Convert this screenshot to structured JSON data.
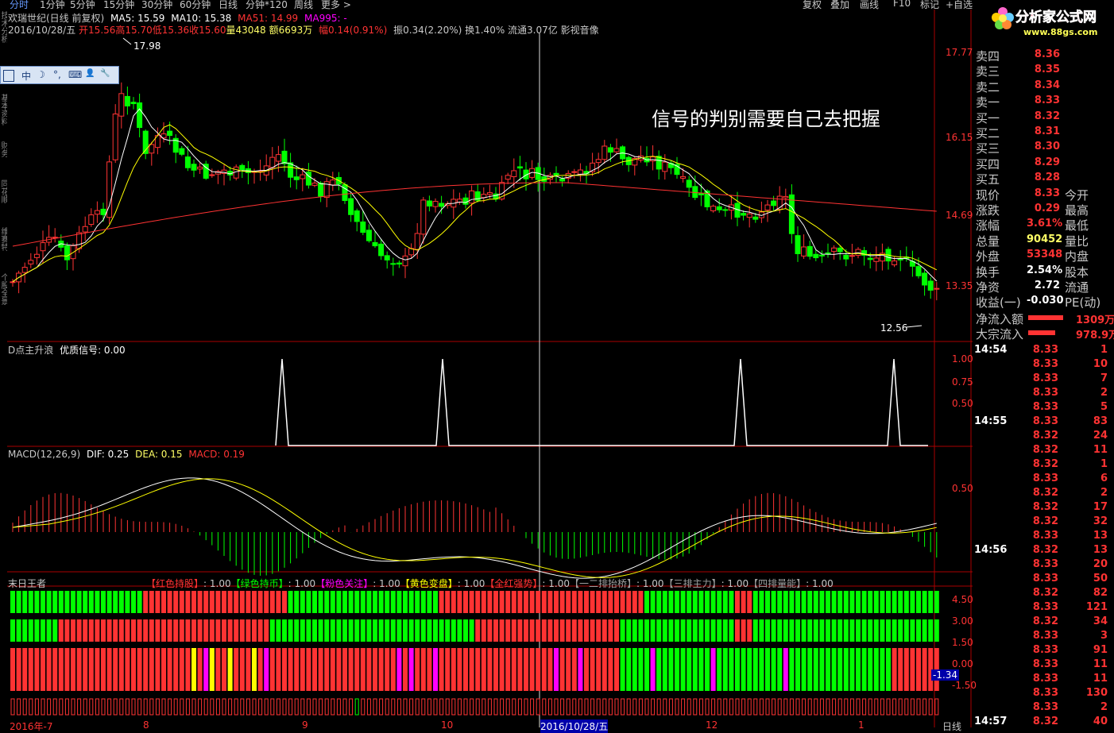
{
  "toolbar": {
    "items": [
      "分时",
      "1分钟",
      "5分钟",
      "15分钟",
      "30分钟",
      "60分钟",
      "日线",
      "分钟*120",
      "周线",
      "更多 >"
    ],
    "right_items": [
      "复权",
      "叠加",
      "画线",
      "F10",
      "标记",
      "+自选"
    ]
  },
  "sidebar_tabs": [
    "技术分析",
    "基本资料",
    "财务",
    "同花顺",
    "维赛特",
    "个股全景"
  ],
  "stock": {
    "title": "欢瑞世纪(日线 前复权)",
    "ma5": "MA5: 15.59",
    "ma10": "MA10: 15.38",
    "ma51": "MA51: 14.99",
    "ma995": "MA995: -",
    "info_date": "2016/10/28/五",
    "info_open": "开15.56",
    "info_high": "高15.70",
    "info_low": "低15.36",
    "info_close": "收15.60",
    "info_vol": "量43048",
    "info_amt": "额6693万",
    "info_chg": "幅0.14(0.91%)",
    "info_rest": "振0.34(2.20%) 换1.40% 流通3.07亿 影视音像",
    "note": "信号的判别需要自己去把握",
    "high_label": "17.98",
    "low_label": "12.56",
    "price_axis": [
      "17.77",
      "16.15",
      "14.69",
      "13.35"
    ]
  },
  "toolbox": {
    "items": [
      "中",
      "☽",
      "°,",
      "⌨",
      "👤",
      "🔧"
    ]
  },
  "logo": {
    "text": "分析家公式网",
    "url": "www.88gs.com"
  },
  "indicator1": {
    "title": "D点主升浪",
    "signal": "优质信号: 0.00",
    "axis": [
      "1.00",
      "0.75",
      "0.50"
    ]
  },
  "macd": {
    "title": "MACD(12,26,9)",
    "dif": "DIF: 0.25",
    "dea": "DEA: 0.15",
    "macd": "MACD: 0.19",
    "axis": [
      "0.50"
    ]
  },
  "indicator3": {
    "title": "末日王者",
    "legend": [
      {
        "label": "【红色持股】",
        "value": ": 1.00",
        "color": "#ff3333"
      },
      {
        "label": "【绿色持币】",
        "value": ": 1.00",
        "color": "#00ff00"
      },
      {
        "label": "【粉色关注】",
        "value": ": 1.00",
        "color": "#ff00ff"
      },
      {
        "label": "【黄色变盘】",
        "value": ": 1.00",
        "color": "#ffff00"
      },
      {
        "label": "【全红强势】",
        "value": ": 1.00",
        "color": "#ff3333"
      },
      {
        "label": "【一二排抬桥】",
        "value": ": 1.00",
        "color": "#a0a0a0"
      },
      {
        "label": "【三排主力】",
        "value": ": 1.00",
        "color": "#a0a0a0"
      },
      {
        "label": "【四排量能】",
        "value": ": 1.00",
        "color": "#a0a0a0"
      }
    ],
    "axis": [
      "4.50",
      "3.00",
      "1.50",
      "0.00",
      "-1.50"
    ],
    "cursor_value": "-1.34"
  },
  "date_axis": [
    "2016年-7",
    "8",
    "9",
    "10",
    "2016/10/28/五",
    "12",
    "1"
  ],
  "period_label": "日线",
  "quote": {
    "rows": [
      {
        "label": "卖四",
        "value": "8.36",
        "vcolor": "#ff3333"
      },
      {
        "label": "卖三",
        "value": "8.35",
        "vcolor": "#ff3333"
      },
      {
        "label": "卖二",
        "value": "8.34",
        "vcolor": "#ff3333"
      },
      {
        "label": "卖一",
        "value": "8.33",
        "vcolor": "#ff3333"
      },
      {
        "label": "买一",
        "value": "8.32",
        "vcolor": "#ff3333"
      },
      {
        "label": "买二",
        "value": "8.31",
        "vcolor": "#ff3333"
      },
      {
        "label": "买三",
        "value": "8.30",
        "vcolor": "#ff3333"
      },
      {
        "label": "买四",
        "value": "8.29",
        "vcolor": "#ff3333"
      },
      {
        "label": "买五",
        "value": "8.28",
        "vcolor": "#ff3333"
      },
      {
        "label": "现价",
        "value": "8.33",
        "vcolor": "#ff3333",
        "label2": "今开"
      },
      {
        "label": "涨跌",
        "value": "0.29",
        "vcolor": "#ff3333",
        "label2": "最高"
      },
      {
        "label": "涨幅",
        "value": "3.61%",
        "vcolor": "#ff3333",
        "label2": "最低"
      },
      {
        "label": "总量",
        "value": "90452",
        "vcolor": "#ffff66",
        "label2": "量比"
      },
      {
        "label": "外盘",
        "value": "53348",
        "vcolor": "#ff3333",
        "label2": "内盘"
      },
      {
        "label": "换手",
        "value": "2.54%",
        "vcolor": "#ffffff",
        "label2": "股本"
      },
      {
        "label": "净资",
        "value": "2.72",
        "vcolor": "#ffffff",
        "label2": "流通"
      },
      {
        "label": "收益(一)",
        "value": "-0.030",
        "vcolor": "#ffffff",
        "label2": "PE(动)"
      }
    ],
    "net_inflow": {
      "label": "净流入额",
      "value": "1309万"
    },
    "block_inflow": {
      "label": "大宗流入",
      "value": "978.9万"
    }
  },
  "ticks": [
    {
      "time": "14:54",
      "price": "8.33",
      "vol": "1",
      "pc": "#ff3333",
      "vc": "#ff3333"
    },
    {
      "time": "",
      "price": "8.33",
      "vol": "10",
      "pc": "#ff3333",
      "vc": "#ff3333"
    },
    {
      "time": "",
      "price": "8.33",
      "vol": "7",
      "pc": "#ff3333",
      "vc": "#ff3333"
    },
    {
      "time": "",
      "price": "8.33",
      "vol": "2",
      "pc": "#ff3333",
      "vc": "#ff3333"
    },
    {
      "time": "",
      "price": "8.33",
      "vol": "5",
      "pc": "#ff3333",
      "vc": "#ff3333"
    },
    {
      "time": "14:55",
      "price": "8.33",
      "vol": "83",
      "pc": "#ff3333",
      "vc": "#ff3333"
    },
    {
      "time": "",
      "price": "8.32",
      "vol": "24",
      "pc": "#ff3333",
      "vc": "#ff3333"
    },
    {
      "time": "",
      "price": "8.32",
      "vol": "11",
      "pc": "#ff3333",
      "vc": "#ff3333"
    },
    {
      "time": "",
      "price": "8.32",
      "vol": "1",
      "pc": "#ff3333",
      "vc": "#ff3333"
    },
    {
      "time": "",
      "price": "8.33",
      "vol": "6",
      "pc": "#ff3333",
      "vc": "#ff3333"
    },
    {
      "time": "",
      "price": "8.32",
      "vol": "2",
      "pc": "#ff3333",
      "vc": "#ff3333"
    },
    {
      "time": "",
      "price": "8.32",
      "vol": "17",
      "pc": "#ff3333",
      "vc": "#ff3333"
    },
    {
      "time": "",
      "price": "8.32",
      "vol": "32",
      "pc": "#ff3333",
      "vc": "#ff3333"
    },
    {
      "time": "",
      "price": "8.33",
      "vol": "13",
      "pc": "#ff3333",
      "vc": "#ff3333"
    },
    {
      "time": "14:56",
      "price": "8.32",
      "vol": "13",
      "pc": "#ff3333",
      "vc": "#ff3333"
    },
    {
      "time": "",
      "price": "8.33",
      "vol": "20",
      "pc": "#ff3333",
      "vc": "#ff3333"
    },
    {
      "time": "",
      "price": "8.33",
      "vol": "50",
      "pc": "#ff3333",
      "vc": "#ff3333"
    },
    {
      "time": "",
      "price": "8.32",
      "vol": "82",
      "pc": "#ff3333",
      "vc": "#ff3333"
    },
    {
      "time": "",
      "price": "8.33",
      "vol": "121",
      "pc": "#ff3333",
      "vc": "#ff3333"
    },
    {
      "time": "",
      "price": "8.32",
      "vol": "34",
      "pc": "#ff3333",
      "vc": "#ff3333"
    },
    {
      "time": "",
      "price": "8.33",
      "vol": "3",
      "pc": "#ff3333",
      "vc": "#ff3333"
    },
    {
      "time": "",
      "price": "8.33",
      "vol": "91",
      "pc": "#ff3333",
      "vc": "#ff3333"
    },
    {
      "time": "",
      "price": "8.33",
      "vol": "11",
      "pc": "#ff3333",
      "vc": "#ff3333"
    },
    {
      "time": "",
      "price": "8.33",
      "vol": "11",
      "pc": "#ff3333",
      "vc": "#ff3333"
    },
    {
      "time": "",
      "price": "8.33",
      "vol": "130",
      "pc": "#ff3333",
      "vc": "#ff3333"
    },
    {
      "time": "",
      "price": "8.33",
      "vol": "2",
      "pc": "#ff3333",
      "vc": "#ff3333"
    },
    {
      "time": "14:57",
      "price": "8.32",
      "vol": "40",
      "pc": "#ff3333",
      "vc": "#ff3333"
    }
  ],
  "colors": {
    "up": "#ff3333",
    "down": "#00ff00",
    "axis": "#ff3333",
    "ma5": "#ffffff",
    "ma10": "#ffff00",
    "ma51": "#ff3333"
  }
}
